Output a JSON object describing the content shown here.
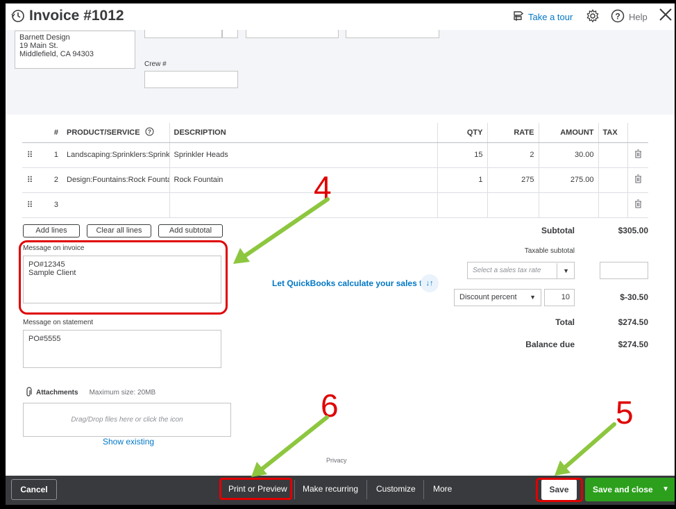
{
  "header": {
    "title": "Invoice #1012",
    "take_tour": "Take a tour",
    "help": "Help"
  },
  "billing": {
    "line1": "Barnett Design",
    "line2": "19 Main St.",
    "line3": "Middlefield, CA  94303"
  },
  "crew_label": "Crew #",
  "table": {
    "columns": {
      "num": "#",
      "product": "PRODUCT/SERVICE",
      "description": "DESCRIPTION",
      "qty": "QTY",
      "rate": "RATE",
      "amount": "AMOUNT",
      "tax": "TAX"
    },
    "rows": [
      {
        "num": "1",
        "product": "Landscaping:Sprinklers:Sprink",
        "description": "Sprinkler Heads",
        "qty": "15",
        "rate": "2",
        "amount": "30.00"
      },
      {
        "num": "2",
        "product": "Design:Fountains:Rock Founta",
        "description": "Rock Fountain",
        "qty": "1",
        "rate": "275",
        "amount": "275.00"
      },
      {
        "num": "3",
        "product": "",
        "description": "",
        "qty": "",
        "rate": "",
        "amount": ""
      }
    ]
  },
  "buttons": {
    "add_lines": "Add lines",
    "clear_all_lines": "Clear all lines",
    "add_subtotal": "Add subtotal"
  },
  "message_invoice": {
    "label": "Message on invoice",
    "line1": "PO#12345",
    "line2": "Sample Client"
  },
  "message_statement": {
    "label": "Message on statement",
    "value": "PO#5555"
  },
  "attachments": {
    "label": "Attachments",
    "max_size": "Maximum size: 20MB",
    "dropzone": "Drag/Drop files here or click the icon",
    "show_existing": "Show existing"
  },
  "privacy": "Privacy",
  "totals": {
    "subtotal_label": "Subtotal",
    "subtotal_value": "$305.00",
    "taxable_subtotal_label": "Taxable subtotal",
    "tax_rate_placeholder": "Select a sales tax rate",
    "qb_calculate": "Let QuickBooks calculate your sales tax",
    "discount_type": "Discount percent",
    "discount_value": "10",
    "discount_amount": "$-30.50",
    "total_label": "Total",
    "total_value": "$274.50",
    "balance_due_label": "Balance due",
    "balance_due_value": "$274.50"
  },
  "footer": {
    "cancel": "Cancel",
    "print_preview": "Print or Preview",
    "make_recurring": "Make recurring",
    "customize": "Customize",
    "more": "More",
    "save": "Save",
    "save_and_close": "Save and close"
  },
  "annotations": {
    "step_4": "4",
    "step_5": "5",
    "step_6": "6"
  },
  "colors": {
    "link_blue": "#0077c5",
    "footer_dark": "#393a3d",
    "save_green": "#2ca01c",
    "annotation_red": "#e00000",
    "arrow_green": "#8dc63f"
  }
}
